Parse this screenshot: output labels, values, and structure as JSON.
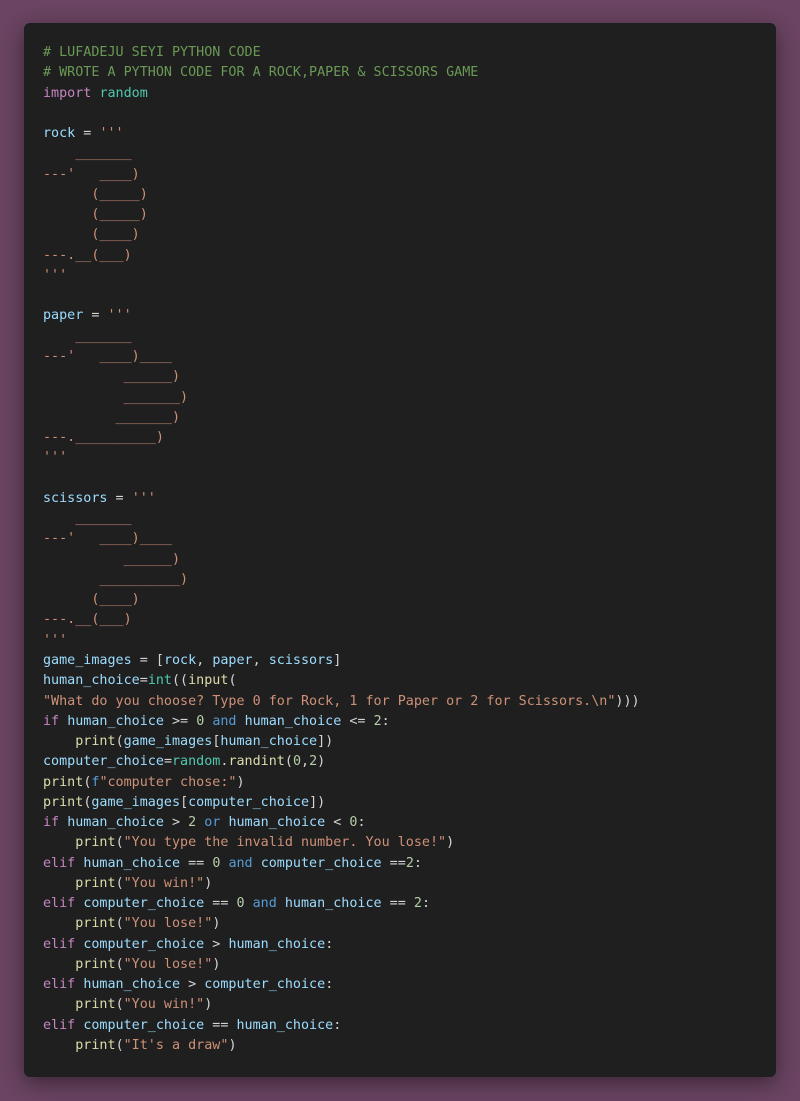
{
  "editor": {
    "theme": {
      "background": "#1f1f1f",
      "page_background": "#6a4462",
      "comment": "#6a9955",
      "keyword": "#c586c0",
      "function": "#dcdcaa",
      "variable": "#9cdcfe",
      "string": "#ce9178",
      "number": "#b5cea8",
      "module": "#4ec9b0",
      "operator_keyword": "#569cd6",
      "plain": "#d4d4d4"
    },
    "lines": [
      [
        [
          "cm",
          "# LUFADEJU SEYI PYTHON CODE"
        ]
      ],
      [
        [
          "cm",
          "# WROTE A PYTHON CODE FOR A ROCK,PAPER & SCISSORS GAME"
        ]
      ],
      [
        [
          "kw",
          "import"
        ],
        [
          "pl",
          " "
        ],
        [
          "md",
          "random"
        ]
      ],
      [],
      [
        [
          "vr",
          "rock"
        ],
        [
          "pl",
          " = "
        ],
        [
          "st",
          "'''"
        ]
      ],
      [
        [
          "st",
          "    _______"
        ]
      ],
      [
        [
          "st",
          "---'   ____)"
        ]
      ],
      [
        [
          "st",
          "      (_____)"
        ]
      ],
      [
        [
          "st",
          "      (_____)"
        ]
      ],
      [
        [
          "st",
          "      (____)"
        ]
      ],
      [
        [
          "st",
          "---.__(___)"
        ]
      ],
      [
        [
          "st",
          "'''"
        ]
      ],
      [],
      [
        [
          "vr",
          "paper"
        ],
        [
          "pl",
          " = "
        ],
        [
          "st",
          "'''"
        ]
      ],
      [
        [
          "st",
          "    _______"
        ]
      ],
      [
        [
          "st",
          "---'   ____)____"
        ]
      ],
      [
        [
          "st",
          "          ______)"
        ]
      ],
      [
        [
          "st",
          "          _______)"
        ]
      ],
      [
        [
          "st",
          "         _______)"
        ]
      ],
      [
        [
          "st",
          "---.__________)"
        ]
      ],
      [
        [
          "st",
          "'''"
        ]
      ],
      [],
      [
        [
          "vr",
          "scissors"
        ],
        [
          "pl",
          " = "
        ],
        [
          "st",
          "'''"
        ]
      ],
      [
        [
          "st",
          "    _______"
        ]
      ],
      [
        [
          "st",
          "---'   ____)____"
        ]
      ],
      [
        [
          "st",
          "          ______)"
        ]
      ],
      [
        [
          "st",
          "       __________)"
        ]
      ],
      [
        [
          "st",
          "      (____)"
        ]
      ],
      [
        [
          "st",
          "---.__(___)"
        ]
      ],
      [
        [
          "st",
          "'''"
        ]
      ],
      [
        [
          "vr",
          "game_images"
        ],
        [
          "pl",
          " = ["
        ],
        [
          "vr",
          "rock"
        ],
        [
          "pl",
          ", "
        ],
        [
          "vr",
          "paper"
        ],
        [
          "pl",
          ", "
        ],
        [
          "vr",
          "scissors"
        ],
        [
          "pl",
          "]"
        ]
      ],
      [
        [
          "vr",
          "human_choice"
        ],
        [
          "pl",
          "="
        ],
        [
          "md",
          "int"
        ],
        [
          "pl",
          "(("
        ],
        [
          "fn",
          "input"
        ],
        [
          "pl",
          "("
        ]
      ],
      [
        [
          "st",
          "\"What do you choose? Type 0 for Rock, 1 for Paper or 2 for Scissors.\\n\""
        ],
        [
          "pl",
          ")))"
        ]
      ],
      [
        [
          "kw",
          "if"
        ],
        [
          "pl",
          " "
        ],
        [
          "vr",
          "human_choice"
        ],
        [
          "pl",
          " >= "
        ],
        [
          "nm",
          "0"
        ],
        [
          "pl",
          " "
        ],
        [
          "op",
          "and"
        ],
        [
          "pl",
          " "
        ],
        [
          "vr",
          "human_choice"
        ],
        [
          "pl",
          " <= "
        ],
        [
          "nm",
          "2"
        ],
        [
          "pl",
          ":"
        ]
      ],
      [
        [
          "pl",
          "    "
        ],
        [
          "fn",
          "print"
        ],
        [
          "pl",
          "("
        ],
        [
          "vr",
          "game_images"
        ],
        [
          "pl",
          "["
        ],
        [
          "vr",
          "human_choice"
        ],
        [
          "pl",
          "])"
        ]
      ],
      [
        [
          "vr",
          "computer_choice"
        ],
        [
          "pl",
          "="
        ],
        [
          "md",
          "random"
        ],
        [
          "pl",
          "."
        ],
        [
          "fn",
          "randint"
        ],
        [
          "pl",
          "("
        ],
        [
          "nm",
          "0"
        ],
        [
          "pl",
          ","
        ],
        [
          "nm",
          "2"
        ],
        [
          "pl",
          ")"
        ]
      ],
      [
        [
          "fn",
          "print"
        ],
        [
          "pl",
          "("
        ],
        [
          "op",
          "f"
        ],
        [
          "st",
          "\"computer chose:\""
        ],
        [
          "pl",
          ")"
        ]
      ],
      [
        [
          "fn",
          "print"
        ],
        [
          "pl",
          "("
        ],
        [
          "vr",
          "game_images"
        ],
        [
          "pl",
          "["
        ],
        [
          "vr",
          "computer_choice"
        ],
        [
          "pl",
          "])"
        ]
      ],
      [
        [
          "kw",
          "if"
        ],
        [
          "pl",
          " "
        ],
        [
          "vr",
          "human_choice"
        ],
        [
          "pl",
          " > "
        ],
        [
          "nm",
          "2"
        ],
        [
          "pl",
          " "
        ],
        [
          "op",
          "or"
        ],
        [
          "pl",
          " "
        ],
        [
          "vr",
          "human_choice"
        ],
        [
          "pl",
          " < "
        ],
        [
          "nm",
          "0"
        ],
        [
          "pl",
          ":"
        ]
      ],
      [
        [
          "pl",
          "    "
        ],
        [
          "fn",
          "print"
        ],
        [
          "pl",
          "("
        ],
        [
          "st",
          "\"You type the invalid number. You lose!\""
        ],
        [
          "pl",
          ")"
        ]
      ],
      [
        [
          "kw",
          "elif"
        ],
        [
          "pl",
          " "
        ],
        [
          "vr",
          "human_choice"
        ],
        [
          "pl",
          " == "
        ],
        [
          "nm",
          "0"
        ],
        [
          "pl",
          " "
        ],
        [
          "op",
          "and"
        ],
        [
          "pl",
          " "
        ],
        [
          "vr",
          "computer_choice"
        ],
        [
          "pl",
          " =="
        ],
        [
          "nm",
          "2"
        ],
        [
          "pl",
          ":"
        ]
      ],
      [
        [
          "pl",
          "    "
        ],
        [
          "fn",
          "print"
        ],
        [
          "pl",
          "("
        ],
        [
          "st",
          "\"You win!\""
        ],
        [
          "pl",
          ")"
        ]
      ],
      [
        [
          "kw",
          "elif"
        ],
        [
          "pl",
          " "
        ],
        [
          "vr",
          "computer_choice"
        ],
        [
          "pl",
          " == "
        ],
        [
          "nm",
          "0"
        ],
        [
          "pl",
          " "
        ],
        [
          "op",
          "and"
        ],
        [
          "pl",
          " "
        ],
        [
          "vr",
          "human_choice"
        ],
        [
          "pl",
          " == "
        ],
        [
          "nm",
          "2"
        ],
        [
          "pl",
          ":"
        ]
      ],
      [
        [
          "pl",
          "    "
        ],
        [
          "fn",
          "print"
        ],
        [
          "pl",
          "("
        ],
        [
          "st",
          "\"You lose!\""
        ],
        [
          "pl",
          ")"
        ]
      ],
      [
        [
          "kw",
          "elif"
        ],
        [
          "pl",
          " "
        ],
        [
          "vr",
          "computer_choice"
        ],
        [
          "pl",
          " > "
        ],
        [
          "vr",
          "human_choice"
        ],
        [
          "pl",
          ":"
        ]
      ],
      [
        [
          "pl",
          "    "
        ],
        [
          "fn",
          "print"
        ],
        [
          "pl",
          "("
        ],
        [
          "st",
          "\"You lose!\""
        ],
        [
          "pl",
          ")"
        ]
      ],
      [
        [
          "kw",
          "elif"
        ],
        [
          "pl",
          " "
        ],
        [
          "vr",
          "human_choice"
        ],
        [
          "pl",
          " > "
        ],
        [
          "vr",
          "computer_choice"
        ],
        [
          "pl",
          ":"
        ]
      ],
      [
        [
          "pl",
          "    "
        ],
        [
          "fn",
          "print"
        ],
        [
          "pl",
          "("
        ],
        [
          "st",
          "\"You win!\""
        ],
        [
          "pl",
          ")"
        ]
      ],
      [
        [
          "kw",
          "elif"
        ],
        [
          "pl",
          " "
        ],
        [
          "vr",
          "computer_choice"
        ],
        [
          "pl",
          " == "
        ],
        [
          "vr",
          "human_choice"
        ],
        [
          "pl",
          ":"
        ]
      ],
      [
        [
          "pl",
          "    "
        ],
        [
          "fn",
          "print"
        ],
        [
          "pl",
          "("
        ],
        [
          "st",
          "\"It's a draw\""
        ],
        [
          "pl",
          ")"
        ]
      ]
    ]
  }
}
